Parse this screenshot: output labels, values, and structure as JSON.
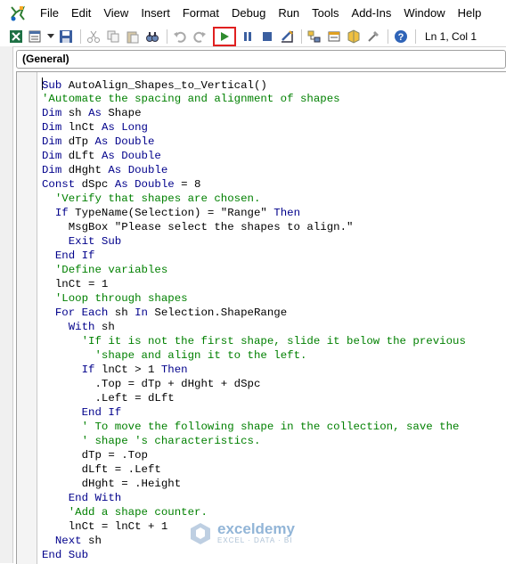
{
  "menu": {
    "items": [
      "File",
      "Edit",
      "View",
      "Insert",
      "Format",
      "Debug",
      "Run",
      "Tools",
      "Add-Ins",
      "Window",
      "Help"
    ]
  },
  "toolbar": {
    "cursor_position": "Ln 1, Col 1",
    "icons": [
      "excel-view-icon",
      "insert-module-icon",
      "cut-icon",
      "copy-icon",
      "paste-icon",
      "find-icon",
      "undo-icon",
      "redo-icon",
      "run-icon",
      "break-icon",
      "reset-icon",
      "design-mode-icon",
      "project-explorer-icon",
      "properties-icon",
      "object-browser-icon",
      "toolbox-icon",
      "help-icon"
    ],
    "highlight_color": "#e02020"
  },
  "procedure_selector": {
    "value": "(General)"
  },
  "colors": {
    "keyword": "#00008b",
    "comment": "#008000",
    "text": "#000000"
  },
  "code": {
    "lines": [
      [
        {
          "t": "Sub",
          "c": "kw"
        },
        {
          "t": " AutoAlign_Shapes_to_Vertical()"
        }
      ],
      [
        {
          "t": "'Automate the spacing and alignment of shapes",
          "c": "cm"
        }
      ],
      [
        {
          "t": "Dim",
          "c": "kw"
        },
        {
          "t": " sh "
        },
        {
          "t": "As",
          "c": "kw"
        },
        {
          "t": " Shape"
        }
      ],
      [
        {
          "t": "Dim",
          "c": "kw"
        },
        {
          "t": " lnCt "
        },
        {
          "t": "As",
          "c": "kw"
        },
        {
          "t": " "
        },
        {
          "t": "Long",
          "c": "kw"
        }
      ],
      [
        {
          "t": "Dim",
          "c": "kw"
        },
        {
          "t": " dTp "
        },
        {
          "t": "As",
          "c": "kw"
        },
        {
          "t": " "
        },
        {
          "t": "Double",
          "c": "kw"
        }
      ],
      [
        {
          "t": "Dim",
          "c": "kw"
        },
        {
          "t": " dLft "
        },
        {
          "t": "As",
          "c": "kw"
        },
        {
          "t": " "
        },
        {
          "t": "Double",
          "c": "kw"
        }
      ],
      [
        {
          "t": "Dim",
          "c": "kw"
        },
        {
          "t": " dHght "
        },
        {
          "t": "As",
          "c": "kw"
        },
        {
          "t": " "
        },
        {
          "t": "Double",
          "c": "kw"
        }
      ],
      [
        {
          "t": "Const",
          "c": "kw"
        },
        {
          "t": " dSpc "
        },
        {
          "t": "As",
          "c": "kw"
        },
        {
          "t": " "
        },
        {
          "t": "Double",
          "c": "kw"
        },
        {
          "t": " = 8"
        }
      ],
      [
        {
          "t": "  "
        },
        {
          "t": "'Verify that shapes are chosen.",
          "c": "cm"
        }
      ],
      [
        {
          "t": "  "
        },
        {
          "t": "If",
          "c": "kw"
        },
        {
          "t": " TypeName(Selection) = \"Range\" "
        },
        {
          "t": "Then",
          "c": "kw"
        }
      ],
      [
        {
          "t": "    MsgBox \"Please select the shapes to align.\""
        }
      ],
      [
        {
          "t": "    "
        },
        {
          "t": "Exit Sub",
          "c": "kw"
        }
      ],
      [
        {
          "t": "  "
        },
        {
          "t": "End If",
          "c": "kw"
        }
      ],
      [
        {
          "t": "  "
        },
        {
          "t": "'Define variables",
          "c": "cm"
        }
      ],
      [
        {
          "t": "  lnCt = 1"
        }
      ],
      [
        {
          "t": "  "
        },
        {
          "t": "'Loop through shapes",
          "c": "cm"
        }
      ],
      [
        {
          "t": "  "
        },
        {
          "t": "For Each",
          "c": "kw"
        },
        {
          "t": " sh "
        },
        {
          "t": "In",
          "c": "kw"
        },
        {
          "t": " Selection.ShapeRange"
        }
      ],
      [
        {
          "t": "    "
        },
        {
          "t": "With",
          "c": "kw"
        },
        {
          "t": " sh"
        }
      ],
      [
        {
          "t": "      "
        },
        {
          "t": "'If it is not the first shape, slide it below the previous",
          "c": "cm"
        }
      ],
      [
        {
          "t": "        "
        },
        {
          "t": "'shape and align it to the left.",
          "c": "cm"
        }
      ],
      [
        {
          "t": "      "
        },
        {
          "t": "If",
          "c": "kw"
        },
        {
          "t": " lnCt > 1 "
        },
        {
          "t": "Then",
          "c": "kw"
        }
      ],
      [
        {
          "t": "        .Top = dTp + dHght + dSpc"
        }
      ],
      [
        {
          "t": "        .Left = dLft"
        }
      ],
      [
        {
          "t": "      "
        },
        {
          "t": "End If",
          "c": "kw"
        }
      ],
      [
        {
          "t": "      "
        },
        {
          "t": "' To move the following shape in the collection, save the",
          "c": "cm"
        }
      ],
      [
        {
          "t": "      "
        },
        {
          "t": "' shape 's characteristics.",
          "c": "cm"
        }
      ],
      [
        {
          "t": "      dTp = .Top"
        }
      ],
      [
        {
          "t": "      dLft = .Left"
        }
      ],
      [
        {
          "t": "      dHght = .Height"
        }
      ],
      [
        {
          "t": "    "
        },
        {
          "t": "End With",
          "c": "kw"
        }
      ],
      [
        {
          "t": "    "
        },
        {
          "t": "'Add a shape counter.",
          "c": "cm"
        }
      ],
      [
        {
          "t": "    lnCt = lnCt + 1"
        }
      ],
      [
        {
          "t": "  "
        },
        {
          "t": "Next",
          "c": "kw"
        },
        {
          "t": " sh"
        }
      ],
      [
        {
          "t": "End Sub",
          "c": "kw"
        }
      ]
    ]
  },
  "watermark": {
    "name": "exceldemy",
    "tagline": "EXCEL · DATA · BI"
  }
}
